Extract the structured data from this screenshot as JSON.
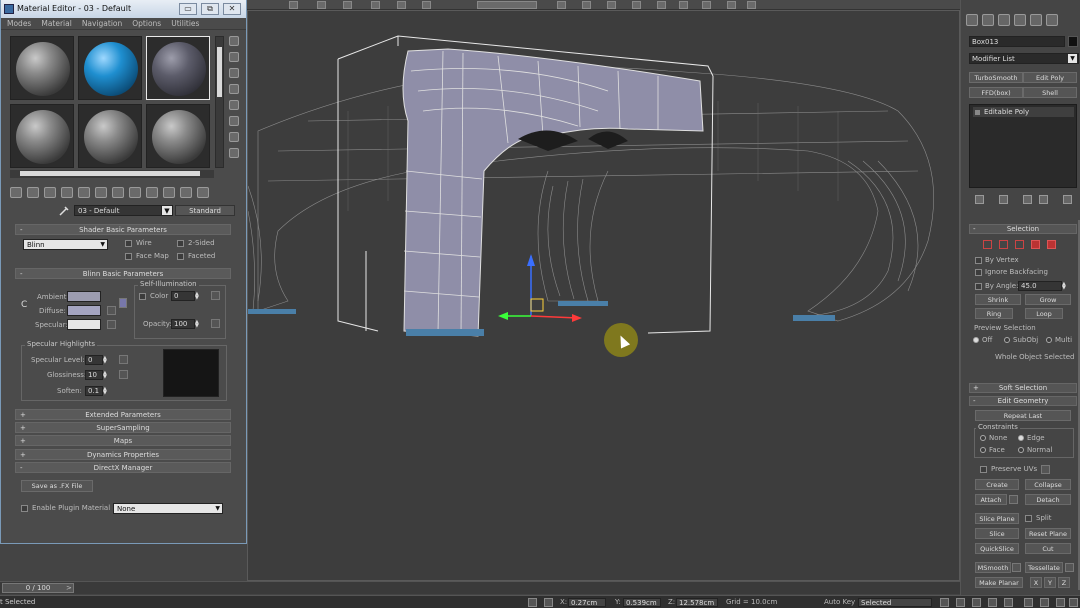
{
  "material_editor": {
    "title": "Material Editor - 03 - Default",
    "window_buttons": {
      "minimize": "▭",
      "restore": "⧉",
      "close": "✕"
    },
    "menu": [
      "Modes",
      "Material",
      "Navigation",
      "Options",
      "Utilities"
    ],
    "material_name": "03 - Default",
    "material_type": "Standard",
    "shader_basic": {
      "header": "Shader Basic Parameters",
      "shader": "Blinn",
      "wire": "Wire",
      "two_sided": "2-Sided",
      "face_map": "Face Map",
      "faceted": "Faceted"
    },
    "blinn_basic": {
      "header": "Blinn Basic Parameters",
      "self_illum": "Self-Illumination",
      "color_label": "Color",
      "color_value": "0",
      "ambient": "Ambient:",
      "diffuse": "Diffuse:",
      "specular": "Specular:",
      "opacity_label": "Opacity:",
      "opacity_value": "100",
      "lock_icon": "C",
      "ambient_color": "#9c9cb0",
      "diffuse_color": "#a4a4c0",
      "specular_color": "#e6e6e6"
    },
    "specular_highlights": {
      "header": "Specular Highlights",
      "level_label": "Specular Level:",
      "level_value": "0",
      "gloss_label": "Glossiness:",
      "gloss_value": "10",
      "soften_label": "Soften:",
      "soften_value": "0.1"
    },
    "rollouts": [
      {
        "sign": "+",
        "label": "Extended Parameters"
      },
      {
        "sign": "+",
        "label": "SuperSampling"
      },
      {
        "sign": "+",
        "label": "Maps"
      },
      {
        "sign": "+",
        "label": "Dynamics Properties"
      },
      {
        "sign": "-",
        "label": "DirectX Manager"
      }
    ],
    "directx": {
      "save_button": "Save as .FX File",
      "enable_plugin": "Enable Plugin Material",
      "plugin_value": "None"
    }
  },
  "timeline": {
    "frame": "0 / 100"
  },
  "status_bar": {
    "text": "t Selected",
    "x_label": "X:",
    "x_value": "0.27cm",
    "y_label": "Y:",
    "y_value": "0.539cm",
    "z_label": "Z:",
    "z_value": "12.578cm",
    "grid": "Grid = 10.0cm",
    "auto_key": "Auto Key",
    "key_filter": "Selected"
  },
  "command_panel": {
    "object_name": "Box013",
    "modifier_list": "Modifier List",
    "mod_buttons": [
      "TurboSmooth",
      "Edit Poly",
      "FFD(box)",
      "Shell"
    ],
    "stack_item": "Editable Poly",
    "selection": {
      "header": "Selection",
      "by_vertex": "By Vertex",
      "ignore_backfacing": "Ignore Backfacing",
      "by_angle": "By Angle:",
      "angle_value": "45.0",
      "shrink": "Shrink",
      "grow": "Grow",
      "ring": "Ring",
      "loop": "Loop",
      "preview_label": "Preview Selection",
      "off": "Off",
      "subobj": "SubObj",
      "multi": "Multi",
      "whole_object": "Whole Object Selected"
    },
    "soft_selection": "Soft Selection",
    "edit_geometry": {
      "header": "Edit Geometry",
      "repeat_last": "Repeat Last",
      "constraints": "Constraints",
      "none": "None",
      "edge": "Edge",
      "face": "Face",
      "normal": "Normal",
      "preserve_uvs": "Preserve UVs",
      "create": "Create",
      "collapse": "Collapse",
      "attach": "Attach",
      "detach": "Detach",
      "slice_plane": "Slice Plane",
      "split": "Split",
      "slice": "Slice",
      "reset_plane": "Reset Plane",
      "quickslice": "QuickSlice",
      "cut": "Cut",
      "msmooth": "MSmooth",
      "tessellate": "Tessellate",
      "make_planar": "Make Planar",
      "x": "X",
      "y": "Y",
      "z": "Z"
    }
  },
  "colors": {
    "accent": "#1f8fd0",
    "title_bar": "#dfe8f2"
  }
}
